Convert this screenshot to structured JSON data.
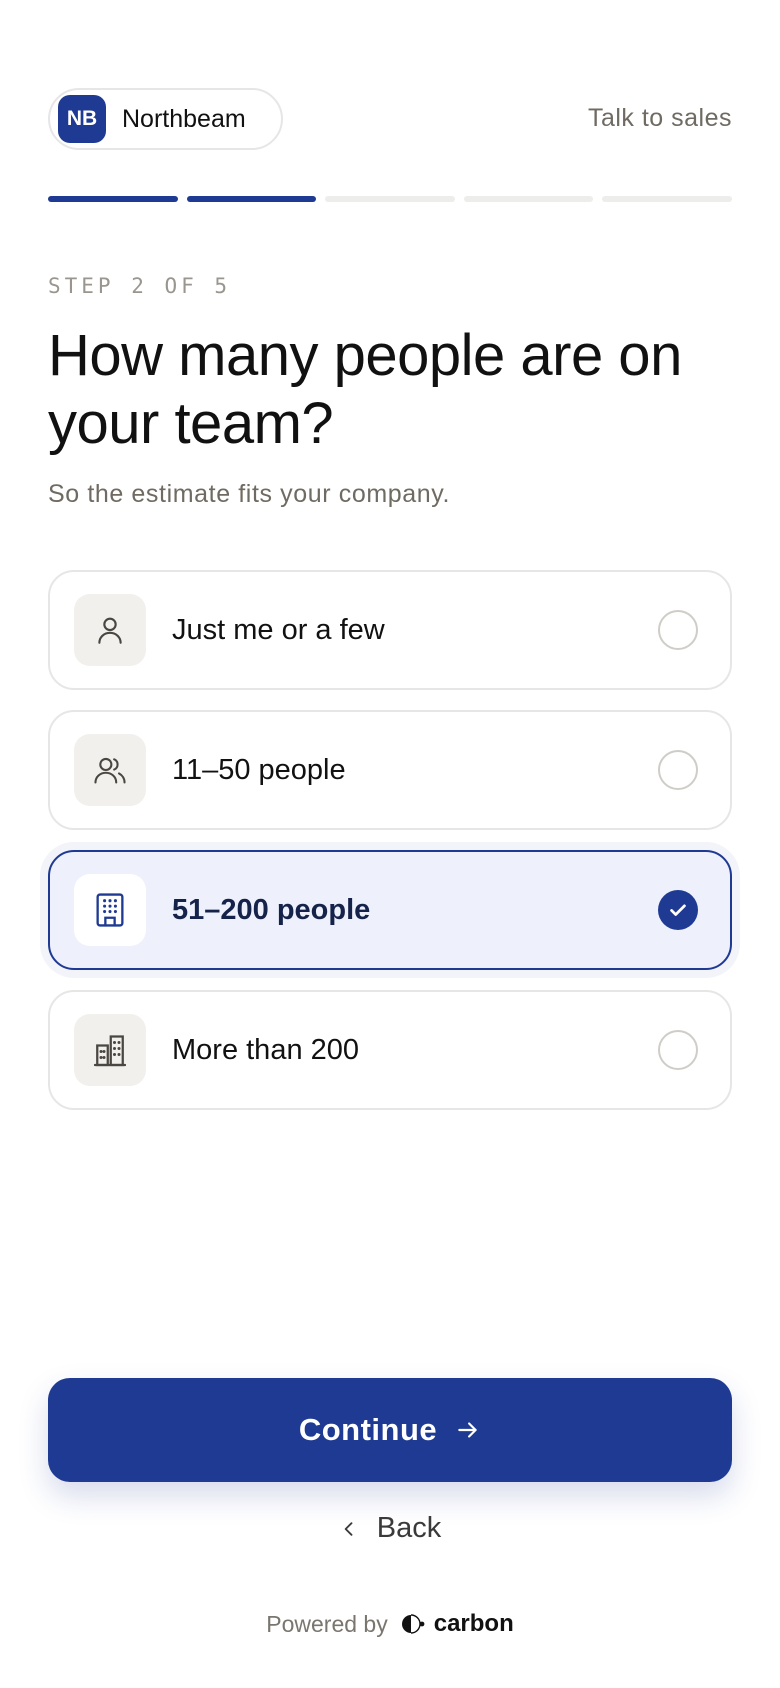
{
  "header": {
    "brand_initials": "NB",
    "brand_name": "Northbeam",
    "talk_to_sales": "Talk to sales"
  },
  "progress": {
    "current_step": 2,
    "total_steps": 5
  },
  "step_label": "STEP 2 OF 5",
  "question": {
    "title": "How many people are on your team?",
    "subtitle": "So the estimate fits your company."
  },
  "options": [
    {
      "label": "Just me or a few",
      "icon": "person-icon",
      "selected": false
    },
    {
      "label": "11–50 people",
      "icon": "people-icon",
      "selected": false
    },
    {
      "label": "51–200 people",
      "icon": "building-icon",
      "selected": true
    },
    {
      "label": "More than 200",
      "icon": "city-buildings-icon",
      "selected": false
    }
  ],
  "actions": {
    "continue_label": "Continue",
    "back_label": "Back"
  },
  "footer": {
    "powered_by": "Powered by",
    "provider": "carbon"
  },
  "colors": {
    "accent": "#1f3a93",
    "selected_bg": "#eef1fb",
    "muted_text": "#6f6a62"
  }
}
